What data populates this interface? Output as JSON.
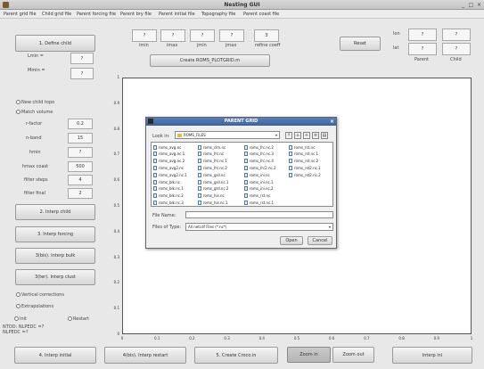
{
  "window": {
    "title": "Nesting GUI"
  },
  "menu": [
    "Parent grid file",
    "Child grid file",
    "Parent forcing file",
    "Parent bry file",
    "Parent initial file",
    "Topography file",
    "Parent coast file"
  ],
  "top_fields": [
    {
      "value": "?",
      "label": "imin"
    },
    {
      "value": "?",
      "label": "imax"
    },
    {
      "value": "?",
      "label": "jmin"
    },
    {
      "value": "?",
      "label": "jmax"
    },
    {
      "value": "3",
      "label": "refine coeff"
    }
  ],
  "create_grid_button": "Create ROMS_PLOTGRID.m",
  "reset_button": "Reset",
  "parent_child": {
    "row_labels": [
      "lon",
      "lat"
    ],
    "col_labels": [
      "Parent",
      "Child"
    ],
    "values": [
      "?",
      "?",
      "?",
      "?"
    ]
  },
  "left": {
    "define_child_button": "1. Define child",
    "lmin_label": "Lmin =",
    "lmin_value": "?",
    "mmin_label": "Mmin =",
    "mmin_value": "?",
    "new_child_topo": "New child topo",
    "match_volume": "Match volume",
    "params": [
      {
        "label": "r-factor",
        "value": "0.2"
      },
      {
        "label": "n-band",
        "value": "15"
      },
      {
        "label": "hmin",
        "value": "?"
      },
      {
        "label": "hmax coast",
        "value": "500"
      },
      {
        "label": "filter steps",
        "value": "4"
      },
      {
        "label": "filter final",
        "value": "2"
      }
    ],
    "interp_child_button": "2. Interp child",
    "interp_forcing_button": "3. Interp forcing",
    "interp_bulk_button": "3(bis). Interp bulk",
    "interp_clust_button": "3(ter). Interp clust",
    "vertical_corrections": "Vertical corrections",
    "extrapolations": "Extrapolations",
    "bottom_radios": [
      "Init",
      "Restart"
    ],
    "status_lines": [
      "NTOD: NLPEDC =?",
      "NLPEDC =?"
    ]
  },
  "plot": {
    "y_ticks": [
      "1",
      "0.9",
      "0.8",
      "0.7",
      "0.6",
      "0.5",
      "0.4",
      "0.3",
      "0.2",
      "0.1",
      "0"
    ],
    "x_ticks": [
      "0",
      "0.1",
      "0.2",
      "0.3",
      "0.4",
      "0.5",
      "0.6",
      "0.7",
      "0.8",
      "0.9",
      "1"
    ]
  },
  "dialog": {
    "title": "PARENT GRID",
    "look_in_label": "Look in:",
    "look_in_value": "ROMS_FILES",
    "files": [
      [
        "roms_avg.nc",
        "roms_clm.nc",
        "roms_frc.nc.2",
        "roms_rst.nc"
      ],
      [
        "roms_avg.nc.1",
        "roms_frc.nc",
        "roms_frc.nc.3",
        "roms_rst.nc.1"
      ],
      [
        "roms_avg.nc.2",
        "roms_frc.nc.1",
        "roms_frc.nc.4",
        "roms_rst.nc.2"
      ],
      [
        "roms_avg2.nc",
        "roms_frc.nc.2",
        "roms_frc2.nc.2",
        "roms_rst2.nc.1"
      ],
      [
        "roms_avg2.nc.1",
        "roms_grd.nc",
        "roms_ini.nc",
        "roms_rst2.nc.2"
      ],
      [
        "roms_blk.nc",
        "roms_grd.nc.1",
        "roms_ini.nc.1",
        ""
      ],
      [
        "roms_blk.nc.1",
        "roms_grd.nc.2",
        "roms_ini.nc.2",
        ""
      ],
      [
        "roms_blk.nc.2",
        "roms_his.nc",
        "roms_rst.nc",
        ""
      ],
      [
        "roms_blk.nc.3",
        "roms_his.nc.1",
        "roms_rst.nc.1",
        ""
      ]
    ],
    "file_name_label": "File Name:",
    "file_name_value": "",
    "files_of_type_label": "Files of Type:",
    "files_of_type_value": "All netcdf Files (*.nc*)",
    "open_button": "Open",
    "cancel_button": "Cancel"
  },
  "bottom_buttons": [
    "4. Interp initial",
    "4(bis). Interp restart",
    "5. Create Croco.in",
    "Zoom in",
    "Zoom out",
    "Interp ini"
  ]
}
